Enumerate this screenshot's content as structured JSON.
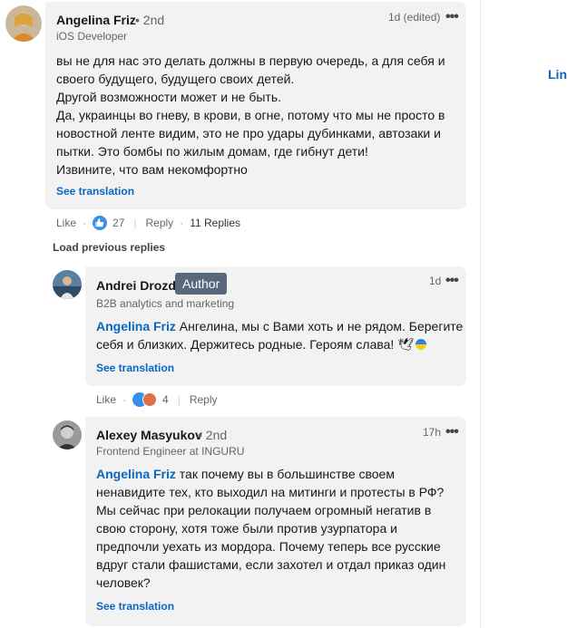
{
  "sidebar_right": {
    "link_text": "Linl",
    "top_mark": "ˇ"
  },
  "comment": {
    "author": "Angelina Friz",
    "degree": "• 2nd",
    "headline": "iOS Developer",
    "time": "1d (edited)",
    "text_lines": [
      "вы не для нас это делать должны в первую очередь, а для себя и",
      "своего будущего, будущего своих детей.",
      "Другой возможности может и не быть.",
      "Да, украинцы во гневу, в крови, в огне, потому что мы не просто в",
      "новостной ленте видим, это не про удары дубинками, автозаки и",
      "пытки. Это бомбы по жилым домам, где гибнут дети!",
      "Извините, что вам некомфортно"
    ],
    "see_translation": "See translation",
    "like_label": "Like",
    "reaction_count": "27",
    "reply_label": "Reply",
    "replies_label": "11 Replies"
  },
  "load_previous": "Load previous replies",
  "reply1": {
    "author": "Andrei Drozd",
    "badge": "Author",
    "headline": "B2B analytics and marketing",
    "time": "1d",
    "mention": "Angelina Friz",
    "line1_rest": " Ангелина, мы с Вами хоть и не рядом. Берегите",
    "line2": "себя и близких. Держитесь родные. Героям слава! 🕊",
    "see_translation": "See translation",
    "like_label": "Like",
    "reaction_count": "4",
    "reply_label": "Reply"
  },
  "reply2": {
    "author": "Alexey Masyukov",
    "degree": "• 2nd",
    "headline": "Frontend Engineer at INGURU",
    "time": "17h",
    "mention": "Angelina Friz",
    "line1_rest": " так почему вы в большинстве своем",
    "lines": [
      "ненавидите тех, кто выходил на митинги и протесты в РФ?",
      "Мы сейчас при релокации получаем огромный негатив в",
      "свою сторону, хотя тоже были против узурпатора и",
      "предпочли уехать из мордора. Почему теперь все русские",
      "вдруг стали фашистами, если захотел и отдал приказ один",
      "человек?"
    ],
    "see_translation": "See translation"
  },
  "colors": {
    "link": "#0a66c2",
    "bubble": "#f2f2f2",
    "badge": "#56687a"
  },
  "icons": {
    "more": "more-icon",
    "like_reaction": "like-reaction-icon",
    "love_reaction": "heart-reaction-icon",
    "flag": "ukraine-flag-icon"
  }
}
